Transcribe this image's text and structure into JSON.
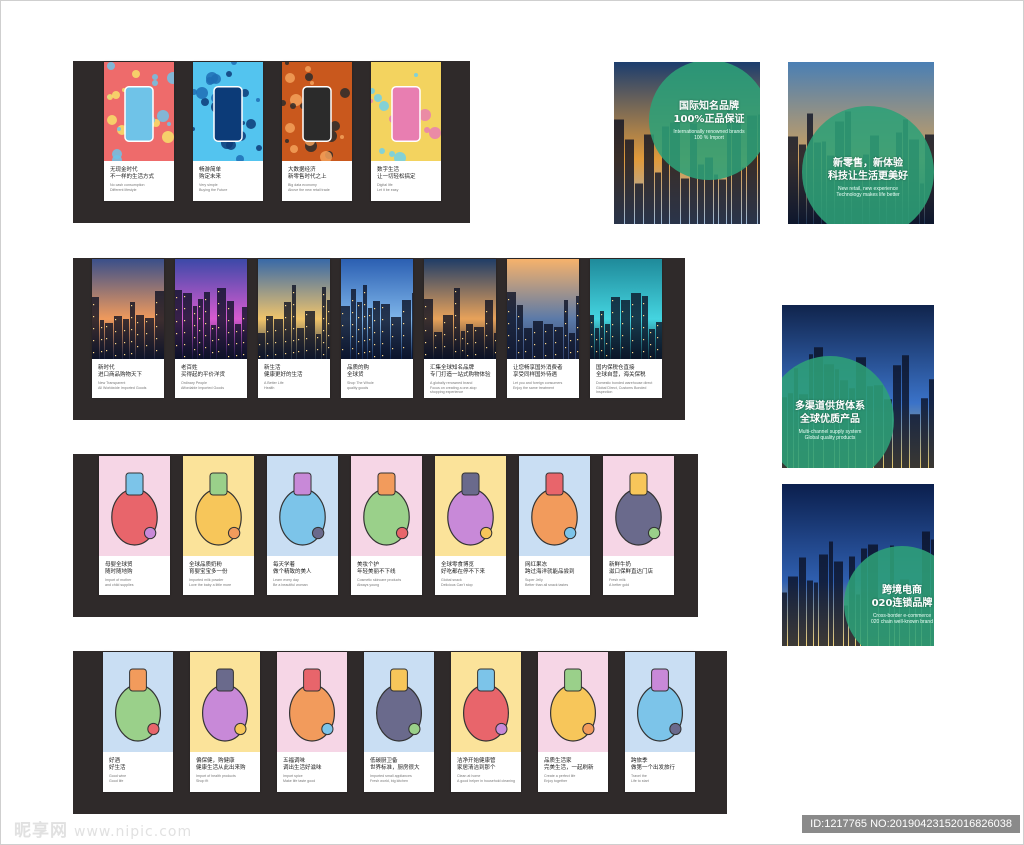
{
  "row1": [
    {
      "icon": "hand-phone-shopping-illustration",
      "title": "无现金时代\n不一样的生活方式",
      "sub": "No cash consumption\nDifferent lifestyle",
      "colors": [
        "#f7e06a",
        "#ee6b6b",
        "#6fc3e8"
      ]
    },
    {
      "icon": "blue-digital-network-illustration",
      "title": "畅游简单\n购定未来",
      "sub": "Very simple\nBuying the Future",
      "colors": [
        "#1f6fb5",
        "#53c4ef",
        "#0c3b78"
      ]
    },
    {
      "icon": "pay-phone-illustration",
      "title": "大数据经济\n新零售时代之上",
      "sub": "Big data economy\nAbove the new retail trade",
      "colors": [
        "#f3a15a",
        "#c9581d",
        "#2b2b2b"
      ]
    },
    {
      "icon": "social-network-people-illustration",
      "title": "数字生活\n让一切轻松搞定",
      "sub": "Digital life\nLet it be easy",
      "colors": [
        "#6fd0ea",
        "#f3d35f",
        "#e87eb1"
      ]
    }
  ],
  "row2": [
    {
      "icon": "city-night-skyline",
      "title": "新时代\n进口商品购物天下",
      "sub": "New Transparent\nAll Worldwide Imported Goods",
      "colors": [
        "#3a4f8a",
        "#f09a5c",
        "#1b2240"
      ]
    },
    {
      "icon": "city-towers-night",
      "title": "老百姓\n买得起的平价洋货",
      "sub": "Ordinary People\nAffordable Imported Goods",
      "colors": [
        "#3c49a8",
        "#d85bd0",
        "#12153a"
      ]
    },
    {
      "icon": "bridge-city-night",
      "title": "新生活\n健康更好的生活",
      "sub": "A Better Life\nHealth",
      "colors": [
        "#3869a8",
        "#f0c46b",
        "#1b2a44"
      ]
    },
    {
      "icon": "blue-dusk-city",
      "title": "品质的购\n全球货",
      "sub": "Shop The Whole\nquality goods",
      "colors": [
        "#2b5fb2",
        "#7fb6ea",
        "#10254e"
      ]
    },
    {
      "icon": "river-city-night",
      "title": "汇集全球知名品牌\n专门打造一站式购物体验",
      "sub": "A globally renowned brand\nFocus on creating a one-stop shopping experience",
      "colors": [
        "#203d67",
        "#e8a25a",
        "#0d1a30"
      ]
    },
    {
      "icon": "eiffel-tower-sunset",
      "title": "让您畅享国外消费者\n享受同样国外待遇",
      "sub": "Let you and foreign consumers\nEnjoy the same treatment",
      "colors": [
        "#f6b26b",
        "#5b7aa8",
        "#30406a"
      ]
    },
    {
      "icon": "teal-city-night",
      "title": "国内保税仓直接\n全球自营，海关保税",
      "sub": "Domestic bonded warehouse direct\nGlobal Direct, Customs Bonded Inspection",
      "colors": [
        "#1f8a9a",
        "#44d4e0",
        "#0d2b3a"
      ]
    }
  ],
  "row3": [
    {
      "icon": "baby-stroller-illustration",
      "title": "母婴全球贸\n随时随地购",
      "sub": "Import of mother\nand child supplies",
      "bg": "#f6d6e6"
    },
    {
      "icon": "baby-bottle-illustration",
      "title": "全球品质奶粉\n育婴宝宝多一份",
      "sub": "Imported milk powder\nLove the baby a little more",
      "bg": "#fbe39a"
    },
    {
      "icon": "skincare-girl-illustration",
      "title": "每天学着\n做个精致的美人",
      "sub": "Learn every day\nBe a beautiful woman",
      "bg": "#c9def3"
    },
    {
      "icon": "perfume-bottle-illustration",
      "title": "美妆个护\n年轻美丽不下线",
      "sub": "Cosmetic skincare products\nAlways young",
      "bg": "#f6d6e6"
    },
    {
      "icon": "cookies-illustration",
      "title": "全球零食博览\n好吃都在停不下来",
      "sub": "Global snack\nDelicious Can't stop",
      "bg": "#fbe39a"
    },
    {
      "icon": "yogurt-cups-illustration",
      "title": "网红果冻\n跨过海洋就能品尝到",
      "sub": "Super Jelly\nBetter than all snack tastes",
      "bg": "#c9def3"
    },
    {
      "icon": "milk-carton-illustration",
      "title": "新鲜牛奶\n滋口保鲜直达门店",
      "sub": "Fresh milk\nA better gold",
      "bg": "#f6d6e6"
    }
  ],
  "row4": [
    {
      "icon": "wine-beer-illustration",
      "title": "好酒\n好生活",
      "sub": "Good wine\nGood life",
      "bg": "#c9def3"
    },
    {
      "icon": "health-pills-illustration",
      "title": "偏保健，购健康\n健康生活从此出来购",
      "sub": "Import of health products\nShop fit",
      "bg": "#fbe39a"
    },
    {
      "icon": "seasoning-bottles-illustration",
      "title": "五福调味\n调出生活好滋味",
      "sub": "Import spice\nMake life taste good",
      "bg": "#f6d6e6"
    },
    {
      "icon": "rice-cooker-illustration",
      "title": "低碳厨卫备\n世界标准，厨房很大",
      "sub": "Imported small appliances\nFresh world, big kitchen",
      "bg": "#c9def3"
    },
    {
      "icon": "cleaning-bottles-illustration",
      "title": "洁净开始健康管\n家居清洁到那个",
      "sub": "Clean at home\nA good helper in household cleaning",
      "bg": "#fbe39a"
    },
    {
      "icon": "toothbrush-cup-illustration",
      "title": "品质生活家\n完美生活，一起刷新",
      "sub": "Create a perfect life\nEnjoy together",
      "bg": "#f6d6e6"
    },
    {
      "icon": "suitcase-illustration",
      "title": "跨旅季\n做第一个出发旅行",
      "sub": "Travel the\nLife to start",
      "bg": "#c9def3"
    }
  ],
  "posters": [
    {
      "icon": "kremlin-night-photo",
      "title": "国际知名品牌\n100%正品保证",
      "sub": "Internationally renowned brands\n100 % Import",
      "colors": [
        "#1c3d6e",
        "#e19a3b",
        "#9ab6d6"
      ]
    },
    {
      "icon": "coastal-city-dusk-photo",
      "title": "新零售，新体验\n科技让生活更美好",
      "sub": "New retail, new experience\nTechnology makes life better",
      "colors": [
        "#4a7fb4",
        "#cfa05e",
        "#1c3354"
      ]
    },
    {
      "icon": "skyscrapers-night-photo",
      "title": "多渠道供货体系\n全球优质产品",
      "sub": "Multi-channel supply system\nGlobal quality products",
      "colors": [
        "#10244c",
        "#3a72c8",
        "#e3c66a"
      ]
    },
    {
      "icon": "bridge-skyline-night-photo",
      "title": "跨境电商\n020连锁品牌",
      "sub": "Cross-border e-commerce\n020 chain well-known brand",
      "colors": [
        "#0b1f4d",
        "#2f5fb0",
        "#f2d27a"
      ]
    }
  ],
  "watermark": {
    "brand": "昵享网",
    "url": "www.nipic.com",
    "id": "ID:1217765 NO:20190423152016826038"
  }
}
